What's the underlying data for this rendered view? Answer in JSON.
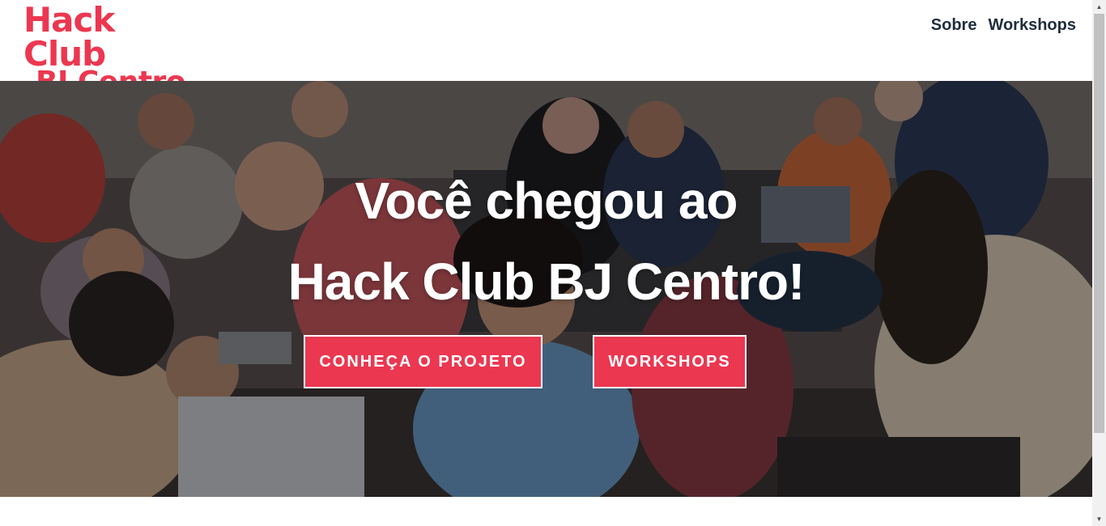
{
  "logo": {
    "line1": "Hack Club",
    "line2": "BJ Centro"
  },
  "nav": {
    "items": [
      {
        "label": "Sobre"
      },
      {
        "label": "Workshops"
      }
    ]
  },
  "hero": {
    "title_line1": "Você chegou ao",
    "title_line2": "Hack Club BJ Centro!",
    "primary_button": "CONHEÇA O PROJETO",
    "secondary_button": "WORKSHOPS",
    "image": "group-of-students-with-laptops-photo"
  },
  "colors": {
    "brand": "#ec3750",
    "nav_text": "#1f2d3d",
    "overlay": "#000000"
  },
  "icons": {
    "scroll_up": "arrow-up-icon",
    "scroll_down": "arrow-down-icon"
  }
}
